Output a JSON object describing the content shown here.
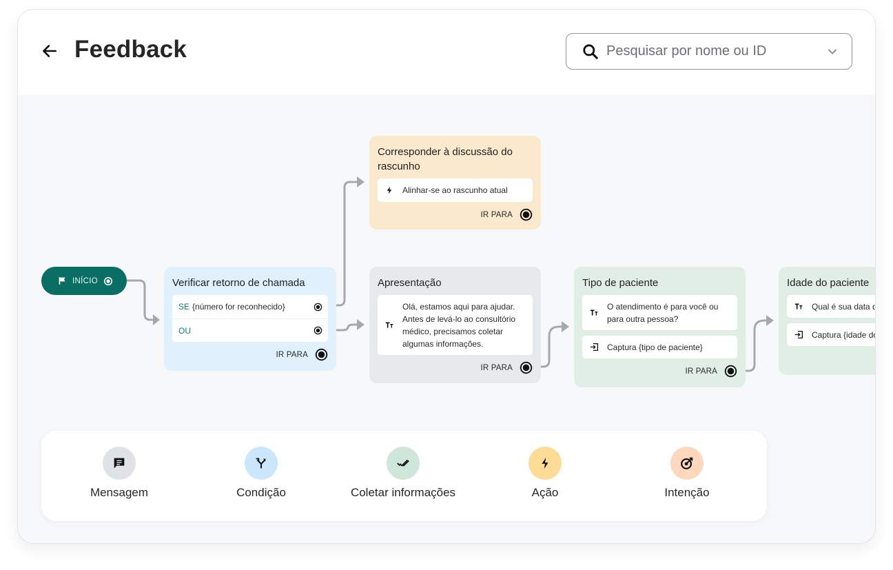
{
  "header": {
    "back_icon": "arrow-left-icon",
    "title": "Feedback",
    "search": {
      "icon": "search-icon",
      "placeholder": "Pesquisar por nome ou ID",
      "dropdown_icon": "chevron-down-icon"
    }
  },
  "flow": {
    "start": {
      "label": "INÍCIO",
      "icon": "flag-icon"
    },
    "nodes": {
      "condition": {
        "title": "Verificar retorno de chamada",
        "color": "#e1f0fd",
        "rows": [
          {
            "keyword": "SE",
            "text": "{número for reconhecido}"
          },
          {
            "keyword": "OU",
            "text": ""
          }
        ],
        "goto_label": "IR PARA"
      },
      "action": {
        "title": "Corresponder à discussão do rascunho",
        "color": "#fbe9cd",
        "cards": [
          {
            "icon": "bolt-icon",
            "text": "Alinhar-se ao rascunho atual"
          }
        ],
        "goto_label": "IR PARA"
      },
      "message": {
        "title": "Apresentação",
        "color": "#e7eaed",
        "cards": [
          {
            "icon": "text-icon",
            "text": "Olá, estamos aqui para ajudar. Antes de levá-lo ao consultório médico, precisamos coletar algumas informações."
          }
        ],
        "goto_label": "IR PARA"
      },
      "patient_type": {
        "title": "Tipo de paciente",
        "color": "#e1eee5",
        "cards": [
          {
            "icon": "text-icon",
            "text": "O atendimento é para você ou para outra pessoa?"
          },
          {
            "icon": "capture-icon",
            "text": "Captura {tipo de paciente}"
          }
        ],
        "goto_label": "IR PARA"
      },
      "patient_age": {
        "title": "Idade do paciente",
        "color": "#e1eee5",
        "cards": [
          {
            "icon": "text-icon",
            "text": "Qual é sua data de nascimento?"
          },
          {
            "icon": "capture-icon",
            "text": "Captura {idade do paciente}"
          }
        ]
      }
    },
    "connector_color": "#a3aaaf"
  },
  "palette": {
    "items": [
      {
        "label": "Mensagem",
        "icon": "message-icon",
        "color": "#dfe3e7"
      },
      {
        "label": "Condição",
        "icon": "split-icon",
        "color": "#cce6fd"
      },
      {
        "label": "Coletar informações",
        "icon": "double-check-icon",
        "color": "#cfe6db"
      },
      {
        "label": "Ação",
        "icon": "bolt-icon",
        "color": "#fddc97"
      },
      {
        "label": "Intenção",
        "icon": "target-icon",
        "color": "#fdd8bd"
      }
    ]
  }
}
